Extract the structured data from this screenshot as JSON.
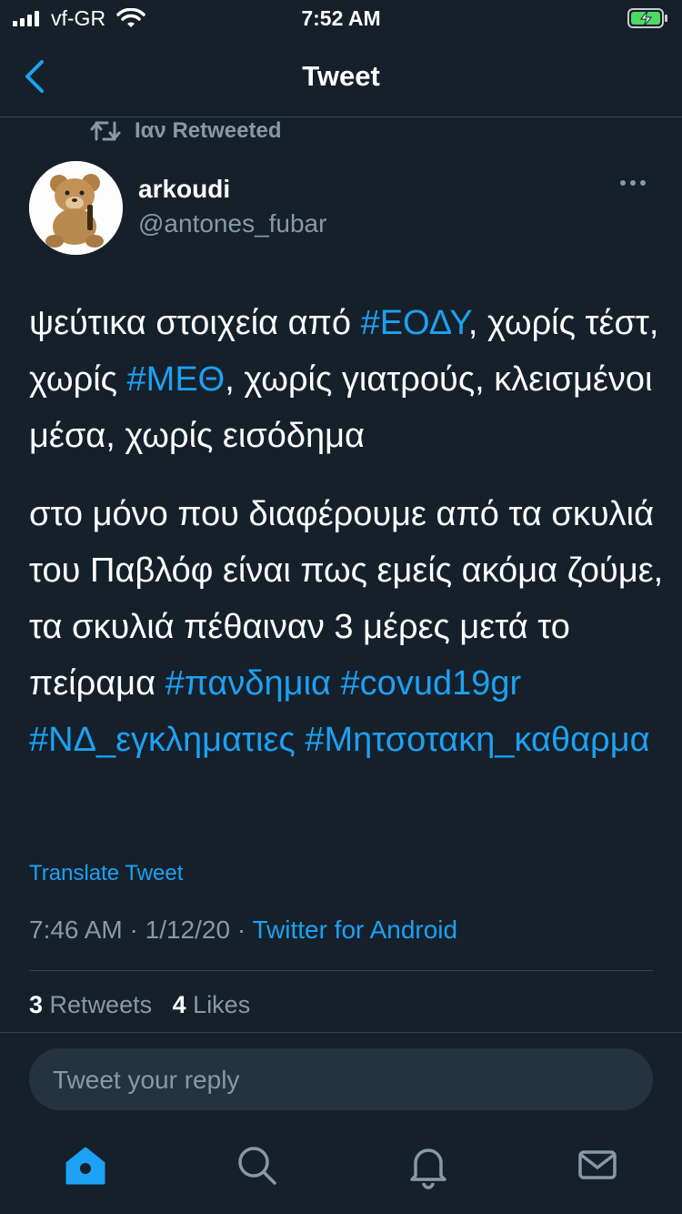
{
  "status": {
    "carrier": "vf-GR",
    "time": "7:52 AM"
  },
  "nav": {
    "title": "Tweet"
  },
  "retweet": {
    "text": "Ιαν Retweeted"
  },
  "author": {
    "name": "arkoudi",
    "handle": "@antones_fubar"
  },
  "tweet": {
    "p1": [
      {
        "t": "ψεύτικα στοιχεία από "
      },
      {
        "t": "#ΕΟΔΥ",
        "tag": true
      },
      {
        "t": ", χωρίς τέστ, χωρίς "
      },
      {
        "t": "#ΜΕΘ",
        "tag": true
      },
      {
        "t": ", χωρίς γιατρούς, κλεισμένοι μέσα, χωρίς εισόδημα"
      }
    ],
    "p2": [
      {
        "t": "στο μόνο που διαφέρουμε από τα σκυλιά του Παβλόφ είναι πως εμείς ακόμα ζούμε, τα σκυλιά πέθαιναν 3 μέρες μετά το πείραμα "
      },
      {
        "t": "#πανδημια",
        "tag": true
      },
      {
        "t": " "
      },
      {
        "t": "#covud19gr",
        "tag": true
      },
      {
        "t": " "
      },
      {
        "t": "#ΝΔ_εγκληματιες",
        "tag": true
      },
      {
        "t": " "
      },
      {
        "t": "#Μητσοτακη_καθαρμα",
        "tag": true
      }
    ],
    "translate_label": "Translate Tweet",
    "time": "7:46 AM",
    "sep": "·",
    "date": "1/12/20",
    "source": "Twitter for Android"
  },
  "stats": {
    "retweets_count": "3",
    "retweets_label": "Retweets",
    "likes_count": "4",
    "likes_label": "Likes"
  },
  "reply": {
    "placeholder": "Tweet your reply"
  },
  "tabs": [
    {
      "icon": "home-icon",
      "active": true
    },
    {
      "icon": "search-icon",
      "active": false
    },
    {
      "icon": "bell-icon",
      "active": false
    },
    {
      "icon": "mail-icon",
      "active": false
    }
  ],
  "colors": {
    "background": "#15202b",
    "accent": "#1da1f2",
    "secondary_text": "#8899a6"
  }
}
